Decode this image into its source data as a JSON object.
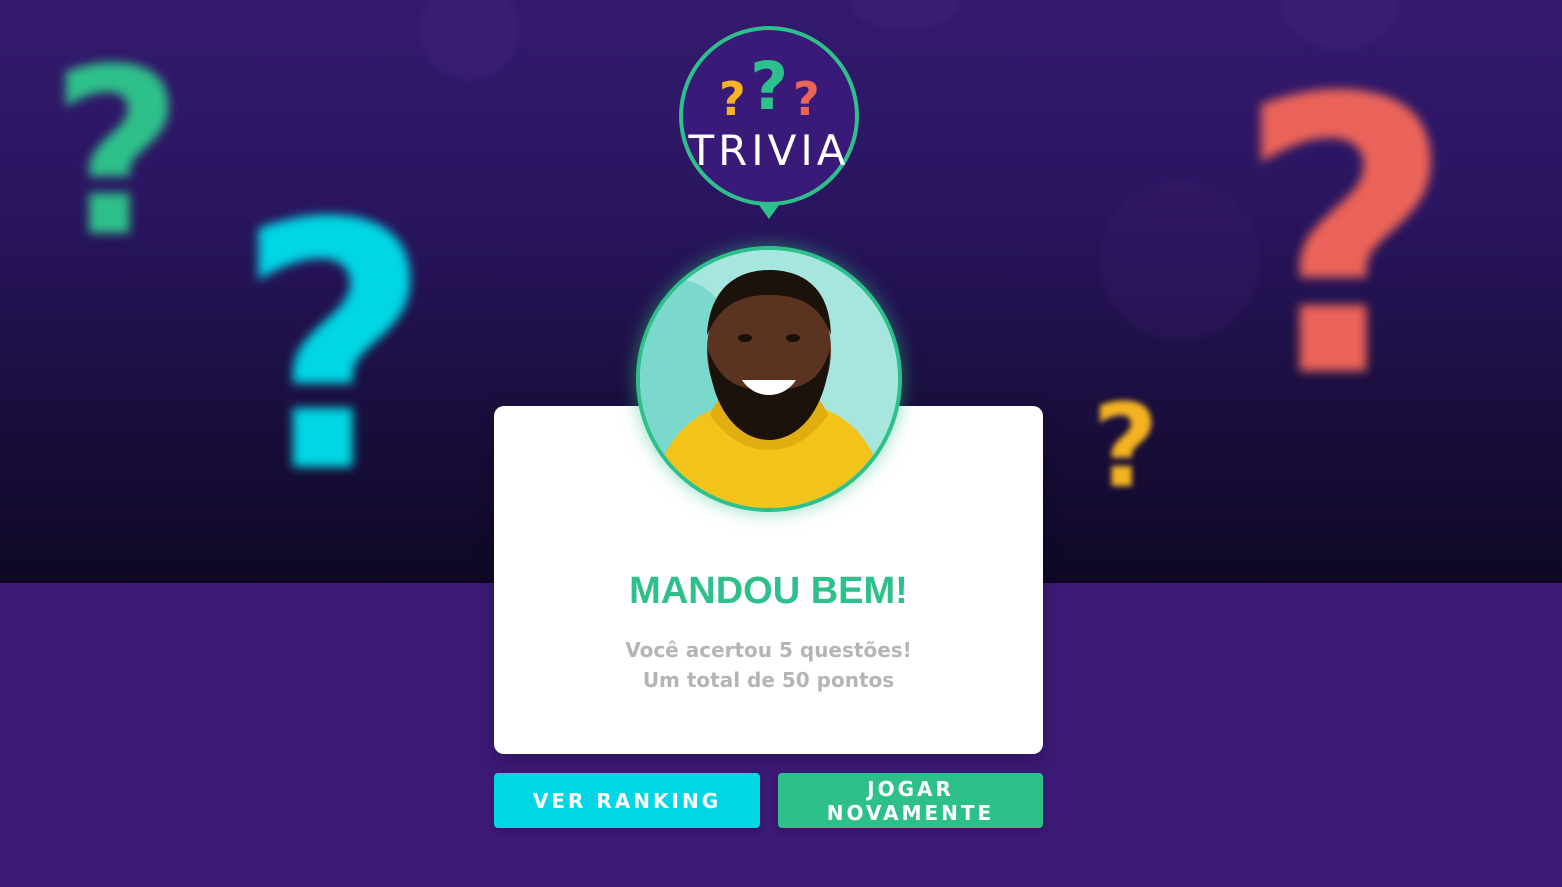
{
  "brand": {
    "logo_text": "TRIVIA",
    "colors": {
      "green": "#2ec08a",
      "cyan": "#00d6e4",
      "red": "#ec6459",
      "yellow": "#f4b321",
      "purple": "#3c1a77"
    }
  },
  "background": {
    "decorations": [
      "question-mark-icon",
      "question-mark-icon",
      "question-mark-icon",
      "question-mark-icon"
    ]
  },
  "result": {
    "title": "MANDOU BEM!",
    "line1": "Você acertou 5 questões!",
    "line2": "Um total de 50 pontos"
  },
  "actions": {
    "ranking_label": "VER RANKING",
    "play_again_label": "JOGAR NOVAMENTE"
  }
}
